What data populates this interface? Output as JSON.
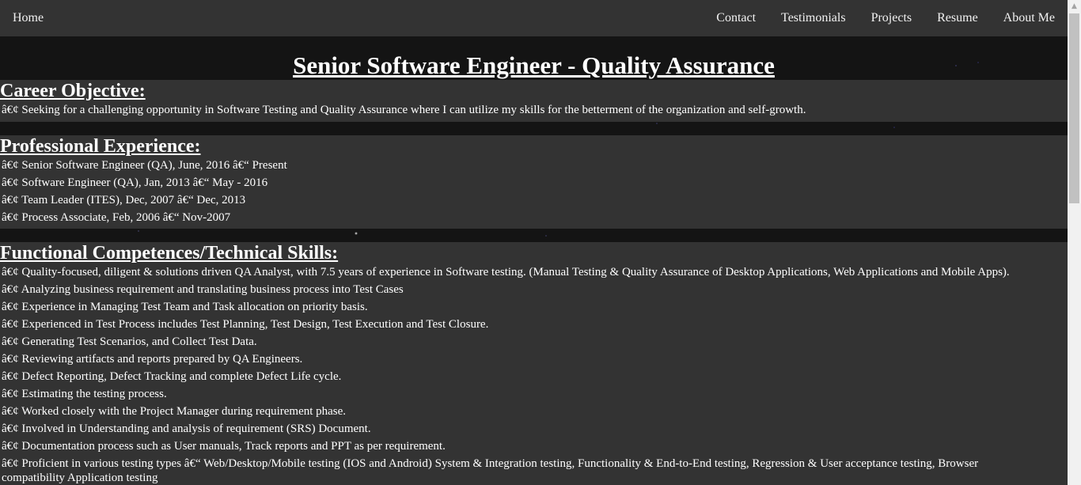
{
  "nav": {
    "home": "Home",
    "links": [
      "Contact",
      "Testimonials",
      "Projects",
      "Resume",
      "About Me"
    ]
  },
  "title": "Senior Software Engineer - Quality Assurance",
  "sections": {
    "career": {
      "heading": "Career Objective:",
      "items": [
        "â€¢ Seeking for a challenging opportunity in Software Testing and Quality Assurance where I can utilize my skills for the betterment of the organization and self-growth."
      ]
    },
    "experience": {
      "heading": "Professional Experience:",
      "items": [
        "â€¢ Senior Software Engineer (QA), June, 2016 â€“ Present",
        "â€¢ Software Engineer (QA), Jan, 2013 â€“ May - 2016",
        "â€¢ Team Leader (ITES), Dec, 2007 â€“ Dec, 2013",
        "â€¢ Process Associate, Feb, 2006 â€“ Nov-2007"
      ]
    },
    "skills": {
      "heading": "Functional Competences/Technical Skills:",
      "items": [
        "â€¢ Quality-focused, diligent & solutions driven QA Analyst, with 7.5 years of experience in Software testing. (Manual Testing & Quality Assurance of Desktop Applications, Web Applications and Mobile Apps).",
        "â€¢ Analyzing business requirement and translating business process into Test Cases",
        "â€¢ Experience in Managing Test Team and Task allocation on priority basis.",
        "â€¢ Experienced in Test Process includes Test Planning, Test Design, Test Execution and Test Closure.",
        "â€¢ Generating Test Scenarios, and Collect Test Data.",
        "â€¢ Reviewing artifacts and reports prepared by QA Engineers.",
        "â€¢ Defect Reporting, Defect Tracking and complete Defect Life cycle.",
        "â€¢ Estimating the testing process.",
        "â€¢ Worked closely with the Project Manager during requirement phase.",
        "â€¢ Involved in Understanding and analysis of requirement (SRS) Document.",
        "â€¢ Documentation process such as User manuals, Track reports and PPT as per requirement.",
        "â€¢ Proficient in various testing types â€“ Web/Desktop/Mobile testing (IOS and Android) System & Integration testing, Functionality & End-to-End testing, Regression & User acceptance testing, Browser compatibility Application testing"
      ]
    }
  },
  "icons": {
    "scroll_up": "scroll-up-arrow-icon"
  }
}
